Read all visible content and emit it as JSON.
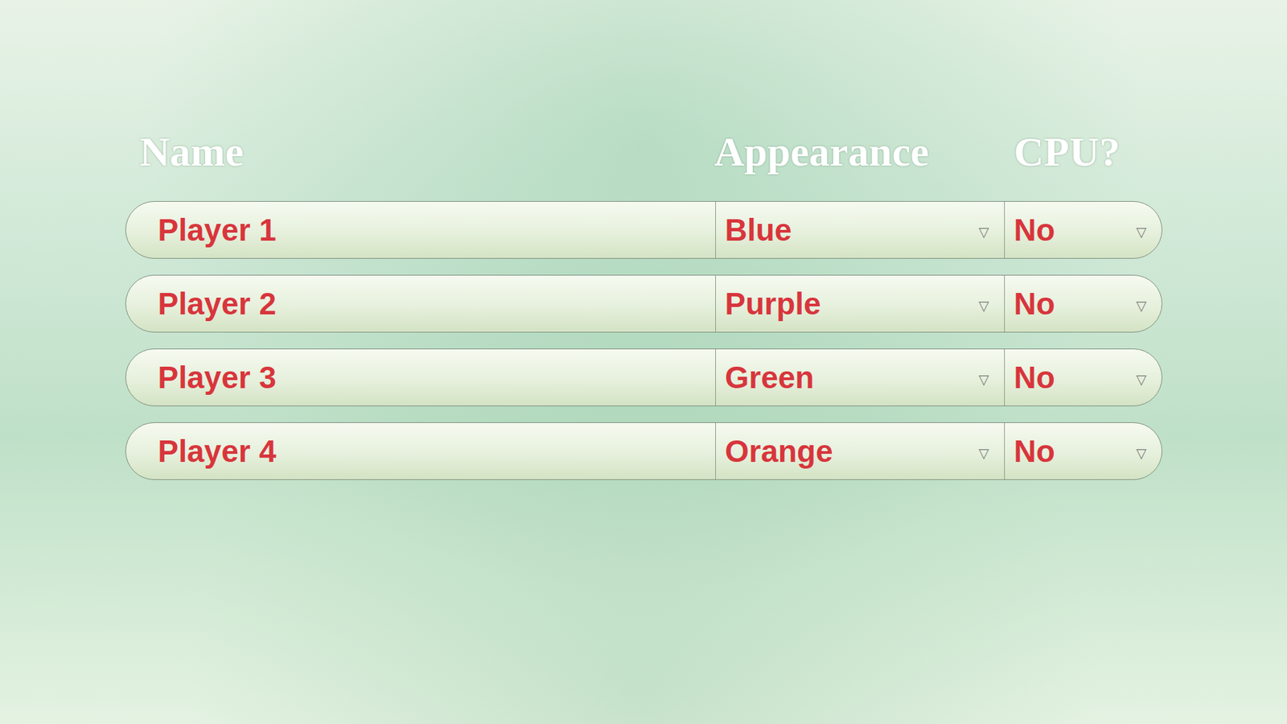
{
  "headers": [
    "Name",
    "Appearance",
    "CPU?"
  ],
  "players": [
    {
      "name": "Player 1",
      "appearance": {
        "value": "Blue",
        "arrow": "▽"
      },
      "cpu": {
        "value": "No",
        "arrow": "▽"
      }
    },
    {
      "name": "Player 2",
      "appearance": {
        "value": "Purple",
        "arrow": "▽"
      },
      "cpu": {
        "value": "No",
        "arrow": "▽"
      }
    },
    {
      "name": "Player 3",
      "appearance": {
        "value": "Green",
        "arrow": "▽"
      },
      "cpu": {
        "value": "No",
        "arrow": "▽"
      }
    },
    {
      "name": "Player 4",
      "appearance": {
        "value": "Orange",
        "arrow": "▽"
      },
      "cpu": {
        "value": "No",
        "arrow": "▽"
      }
    }
  ]
}
